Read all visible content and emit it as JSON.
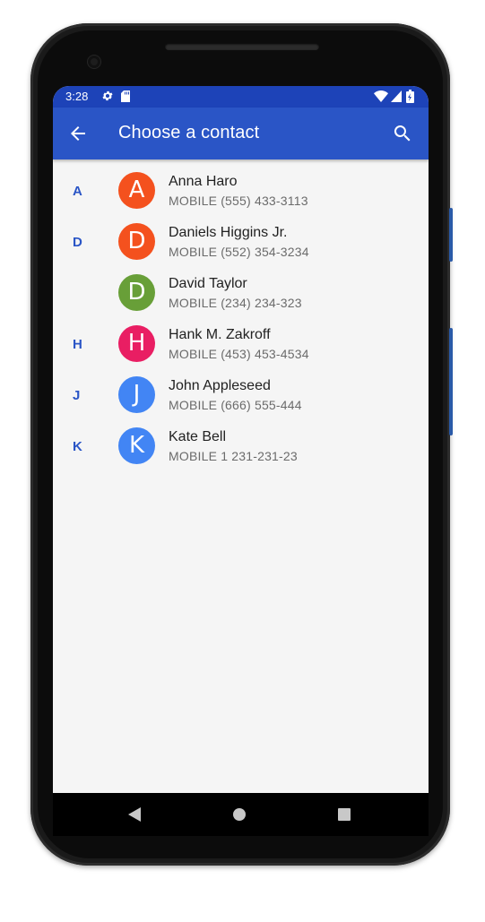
{
  "status_bar": {
    "time": "3:28",
    "icons": [
      "gear-icon",
      "sd-card-icon",
      "wifi-icon",
      "signal-icon",
      "battery-charging-icon"
    ]
  },
  "app_bar": {
    "title": "Choose a contact",
    "back_icon": "arrow-back-icon",
    "search_icon": "search-icon",
    "color": "#2a55c6",
    "status_color": "#1d43b8"
  },
  "contacts": [
    {
      "section": "A",
      "initial": "A",
      "name": "Anna Haro",
      "phone": "MOBILE (555) 433-3113",
      "color": "#f4511e"
    },
    {
      "section": "D",
      "initial": "D",
      "name": "Daniels Higgins Jr.",
      "phone": "MOBILE (552) 354-3234",
      "color": "#f4511e"
    },
    {
      "section": "",
      "initial": "D",
      "name": "David Taylor",
      "phone": "MOBILE (234) 234-323",
      "color": "#689f38"
    },
    {
      "section": "H",
      "initial": "H",
      "name": "Hank M. Zakroff",
      "phone": "MOBILE (453) 453-4534",
      "color": "#e91e63"
    },
    {
      "section": "J",
      "initial": "J",
      "name": "John Appleseed",
      "phone": "MOBILE (666) 555-444",
      "color": "#4285f4"
    },
    {
      "section": "K",
      "initial": "K",
      "name": "Kate Bell",
      "phone": "MOBILE 1 231-231-23",
      "color": "#4285f4"
    }
  ],
  "nav_bar": {
    "icons": [
      "nav-back-icon",
      "nav-home-icon",
      "nav-recents-icon"
    ]
  }
}
